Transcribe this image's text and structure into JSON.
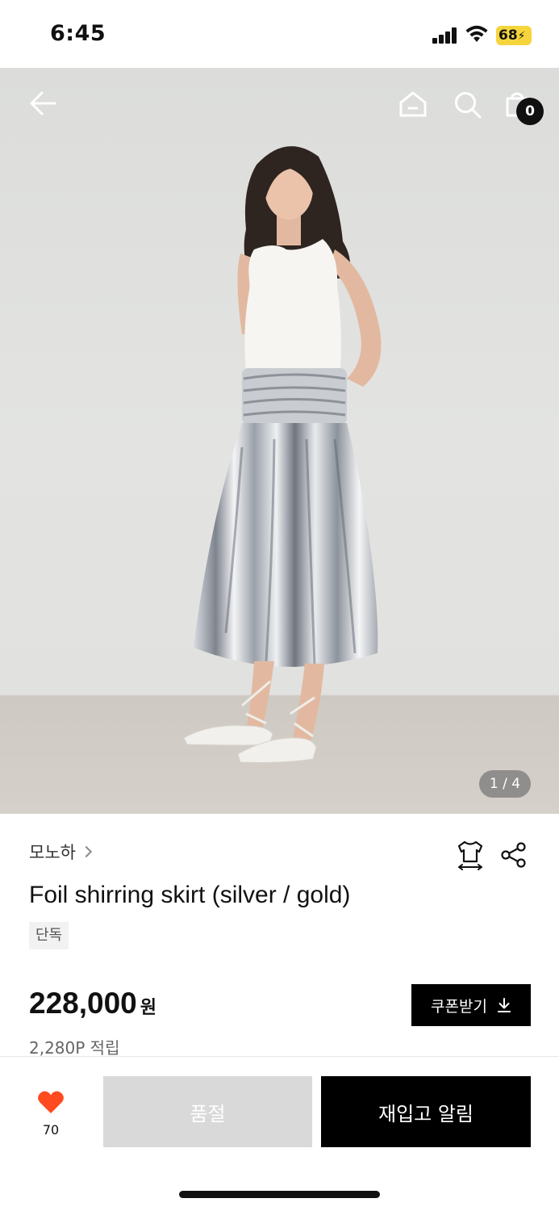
{
  "status_bar": {
    "time": "6:45",
    "battery": "68",
    "icons": [
      "signal-icon",
      "wifi-icon",
      "battery-charging-icon"
    ]
  },
  "header": {
    "icons": [
      "back-arrow-icon",
      "home-icon",
      "search-icon",
      "shopping-bag-icon"
    ],
    "cart_count": "0"
  },
  "gallery": {
    "counter": "1 / 4",
    "current": 1,
    "total": 4
  },
  "product": {
    "brand": "모노하",
    "title": "Foil shirring skirt (silver / gold)",
    "tag": "단독",
    "price": "228,000",
    "price_unit": "원",
    "points": "2,280P 적립",
    "coupon_label": "쿠폰받기",
    "icons": [
      "size-fit-icon",
      "share-icon",
      "download-icon",
      "chevron-right-icon"
    ]
  },
  "bottom_bar": {
    "like_count": "70",
    "soldout_label": "품절",
    "restock_label": "재입고 알림",
    "accent_color": "#ff4b1f"
  }
}
